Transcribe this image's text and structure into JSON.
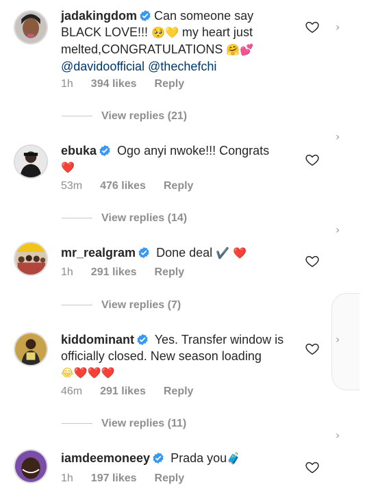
{
  "comments": [
    {
      "username": "jadakingdom",
      "text_parts": [
        "Can someone say BLACK LOVE!!! ",
        " my heart just melted,CONGRATULATIONS "
      ],
      "emojis": [
        "🥺",
        "💛",
        "🤗",
        "💕"
      ],
      "mentions": [
        "@davidoofficial",
        "@thechefchi"
      ],
      "time": "1h",
      "likes": "394 likes",
      "reply": "Reply",
      "view_replies": "View replies (21)"
    },
    {
      "username": "ebuka",
      "text": "Ogo anyi nwoke!!! Congrats",
      "emojis": [
        "❤️"
      ],
      "time": "53m",
      "likes": "476 likes",
      "reply": "Reply",
      "view_replies": "View replies (14)"
    },
    {
      "username": "mr_realgram",
      "text": "Done deal",
      "emojis": [
        "✔️",
        "❤️"
      ],
      "time": "1h",
      "likes": "291 likes",
      "reply": "Reply",
      "view_replies": "View replies (7)"
    },
    {
      "username": "kiddominant",
      "text": "Yes. Transfer window is officially closed. New season loading",
      "emojis": [
        "😂",
        "❤️",
        "❤️",
        "❤️"
      ],
      "time": "46m",
      "likes": "291 likes",
      "reply": "Reply",
      "view_replies": "View replies (11)"
    },
    {
      "username": "iamdeemoneey",
      "text": "Prada you",
      "emojis": [
        "🧳"
      ],
      "time": "1h",
      "likes": "197 likes",
      "reply": "Reply"
    }
  ],
  "icons": {
    "like": "heart-outline-icon",
    "verified": "verified-badge-icon",
    "chevron": "chevron-right-icon"
  },
  "colors": {
    "verified": "#3897f0",
    "meta": "#8e8e8e",
    "text": "#262626",
    "heart": "#e0112b"
  }
}
